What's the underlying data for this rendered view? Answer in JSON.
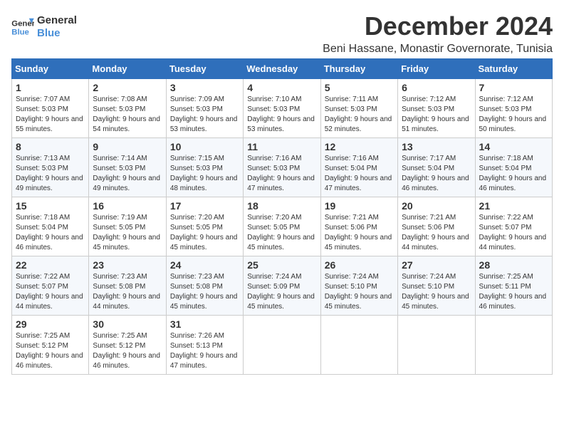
{
  "header": {
    "logo_text_general": "General",
    "logo_text_blue": "Blue",
    "month_title": "December 2024",
    "location": "Beni Hassane, Monastir Governorate, Tunisia"
  },
  "weekdays": [
    "Sunday",
    "Monday",
    "Tuesday",
    "Wednesday",
    "Thursday",
    "Friday",
    "Saturday"
  ],
  "weeks": [
    [
      {
        "day": "1",
        "sunrise": "7:07 AM",
        "sunset": "5:03 PM",
        "daylight": "9 hours and 55 minutes."
      },
      {
        "day": "2",
        "sunrise": "7:08 AM",
        "sunset": "5:03 PM",
        "daylight": "9 hours and 54 minutes."
      },
      {
        "day": "3",
        "sunrise": "7:09 AM",
        "sunset": "5:03 PM",
        "daylight": "9 hours and 53 minutes."
      },
      {
        "day": "4",
        "sunrise": "7:10 AM",
        "sunset": "5:03 PM",
        "daylight": "9 hours and 53 minutes."
      },
      {
        "day": "5",
        "sunrise": "7:11 AM",
        "sunset": "5:03 PM",
        "daylight": "9 hours and 52 minutes."
      },
      {
        "day": "6",
        "sunrise": "7:12 AM",
        "sunset": "5:03 PM",
        "daylight": "9 hours and 51 minutes."
      },
      {
        "day": "7",
        "sunrise": "7:12 AM",
        "sunset": "5:03 PM",
        "daylight": "9 hours and 50 minutes."
      }
    ],
    [
      {
        "day": "8",
        "sunrise": "7:13 AM",
        "sunset": "5:03 PM",
        "daylight": "9 hours and 49 minutes."
      },
      {
        "day": "9",
        "sunrise": "7:14 AM",
        "sunset": "5:03 PM",
        "daylight": "9 hours and 49 minutes."
      },
      {
        "day": "10",
        "sunrise": "7:15 AM",
        "sunset": "5:03 PM",
        "daylight": "9 hours and 48 minutes."
      },
      {
        "day": "11",
        "sunrise": "7:16 AM",
        "sunset": "5:03 PM",
        "daylight": "9 hours and 47 minutes."
      },
      {
        "day": "12",
        "sunrise": "7:16 AM",
        "sunset": "5:04 PM",
        "daylight": "9 hours and 47 minutes."
      },
      {
        "day": "13",
        "sunrise": "7:17 AM",
        "sunset": "5:04 PM",
        "daylight": "9 hours and 46 minutes."
      },
      {
        "day": "14",
        "sunrise": "7:18 AM",
        "sunset": "5:04 PM",
        "daylight": "9 hours and 46 minutes."
      }
    ],
    [
      {
        "day": "15",
        "sunrise": "7:18 AM",
        "sunset": "5:04 PM",
        "daylight": "9 hours and 46 minutes."
      },
      {
        "day": "16",
        "sunrise": "7:19 AM",
        "sunset": "5:05 PM",
        "daylight": "9 hours and 45 minutes."
      },
      {
        "day": "17",
        "sunrise": "7:20 AM",
        "sunset": "5:05 PM",
        "daylight": "9 hours and 45 minutes."
      },
      {
        "day": "18",
        "sunrise": "7:20 AM",
        "sunset": "5:05 PM",
        "daylight": "9 hours and 45 minutes."
      },
      {
        "day": "19",
        "sunrise": "7:21 AM",
        "sunset": "5:06 PM",
        "daylight": "9 hours and 45 minutes."
      },
      {
        "day": "20",
        "sunrise": "7:21 AM",
        "sunset": "5:06 PM",
        "daylight": "9 hours and 44 minutes."
      },
      {
        "day": "21",
        "sunrise": "7:22 AM",
        "sunset": "5:07 PM",
        "daylight": "9 hours and 44 minutes."
      }
    ],
    [
      {
        "day": "22",
        "sunrise": "7:22 AM",
        "sunset": "5:07 PM",
        "daylight": "9 hours and 44 minutes."
      },
      {
        "day": "23",
        "sunrise": "7:23 AM",
        "sunset": "5:08 PM",
        "daylight": "9 hours and 44 minutes."
      },
      {
        "day": "24",
        "sunrise": "7:23 AM",
        "sunset": "5:08 PM",
        "daylight": "9 hours and 45 minutes."
      },
      {
        "day": "25",
        "sunrise": "7:24 AM",
        "sunset": "5:09 PM",
        "daylight": "9 hours and 45 minutes."
      },
      {
        "day": "26",
        "sunrise": "7:24 AM",
        "sunset": "5:10 PM",
        "daylight": "9 hours and 45 minutes."
      },
      {
        "day": "27",
        "sunrise": "7:24 AM",
        "sunset": "5:10 PM",
        "daylight": "9 hours and 45 minutes."
      },
      {
        "day": "28",
        "sunrise": "7:25 AM",
        "sunset": "5:11 PM",
        "daylight": "9 hours and 46 minutes."
      }
    ],
    [
      {
        "day": "29",
        "sunrise": "7:25 AM",
        "sunset": "5:12 PM",
        "daylight": "9 hours and 46 minutes."
      },
      {
        "day": "30",
        "sunrise": "7:25 AM",
        "sunset": "5:12 PM",
        "daylight": "9 hours and 46 minutes."
      },
      {
        "day": "31",
        "sunrise": "7:26 AM",
        "sunset": "5:13 PM",
        "daylight": "9 hours and 47 minutes."
      },
      null,
      null,
      null,
      null
    ]
  ]
}
